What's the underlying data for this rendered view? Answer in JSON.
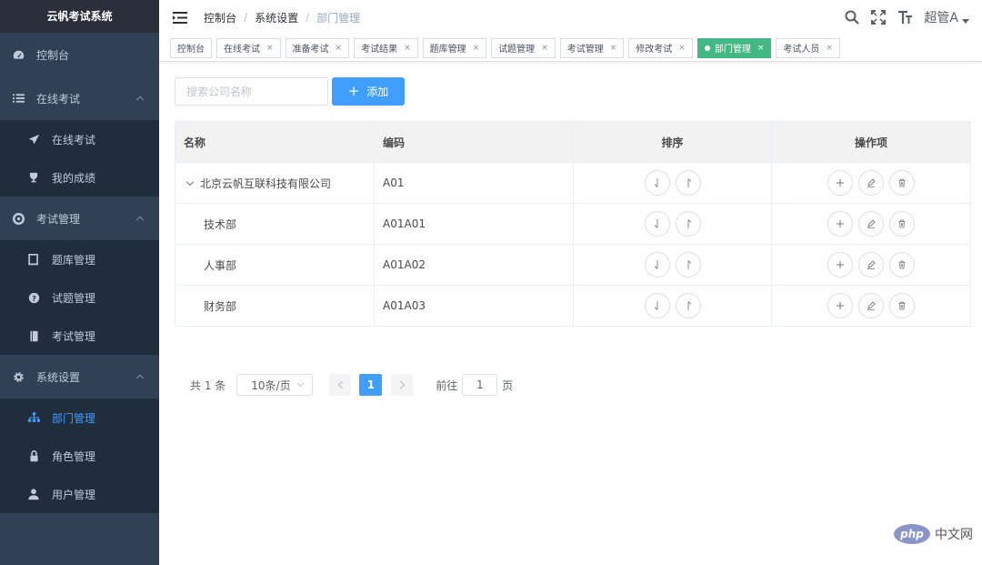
{
  "app": {
    "title": "云帆考试系统"
  },
  "sidebar": {
    "items": [
      {
        "label": "控制台",
        "icon": "dashboard-icon"
      },
      {
        "label": "在线考试",
        "icon": "list-icon",
        "children": [
          {
            "label": "在线考试",
            "icon": "paper-plane-icon"
          },
          {
            "label": "我的成绩",
            "icon": "trophy-icon"
          }
        ]
      },
      {
        "label": "考试管理",
        "icon": "life-ring-icon",
        "children": [
          {
            "label": "题库管理",
            "icon": "notebook-icon"
          },
          {
            "label": "试题管理",
            "icon": "question-icon"
          },
          {
            "label": "考试管理",
            "icon": "book-icon"
          }
        ]
      },
      {
        "label": "系统设置",
        "icon": "gear-icon",
        "children": [
          {
            "label": "部门管理",
            "icon": "org-tree-icon",
            "active": true
          },
          {
            "label": "角色管理",
            "icon": "lock-icon"
          },
          {
            "label": "用户管理",
            "icon": "user-icon"
          }
        ]
      }
    ]
  },
  "navbar": {
    "breadcrumb": [
      "控制台",
      "系统设置",
      "部门管理"
    ],
    "user": "超管A"
  },
  "tags": [
    {
      "label": "控制台",
      "closable": false
    },
    {
      "label": "在线考试",
      "closable": true
    },
    {
      "label": "准备考试",
      "closable": true
    },
    {
      "label": "考试结果",
      "closable": true
    },
    {
      "label": "题库管理",
      "closable": true
    },
    {
      "label": "试题管理",
      "closable": true
    },
    {
      "label": "考试管理",
      "closable": true
    },
    {
      "label": "修改考试",
      "closable": true
    },
    {
      "label": "部门管理",
      "closable": true,
      "active": true
    },
    {
      "label": "考试人员",
      "closable": true
    }
  ],
  "toolbar": {
    "search_placeholder": "搜索公司名称",
    "add_label": "添加"
  },
  "table": {
    "columns": [
      "名称",
      "编码",
      "排序",
      "操作项"
    ],
    "rows": [
      {
        "name": "北京云帆互联科技有限公司",
        "code": "A01",
        "expanded": true,
        "level": 0
      },
      {
        "name": "技术部",
        "code": "A01A01",
        "level": 1
      },
      {
        "name": "人事部",
        "code": "A01A02",
        "level": 1
      },
      {
        "name": "财务部",
        "code": "A01A03",
        "level": 1
      }
    ]
  },
  "pagination": {
    "total_text": "共 1 条",
    "page_size": "10条/页",
    "current_page": "1",
    "goto_label": "前往",
    "goto_value": "1",
    "goto_suffix": "页"
  },
  "watermark": {
    "logo": "php",
    "text": "中文网"
  },
  "colors": {
    "primary": "#409eff",
    "active_tag": "#42b983",
    "sidebar_bg": "#304156",
    "submenu_bg": "#1f2d3d"
  }
}
